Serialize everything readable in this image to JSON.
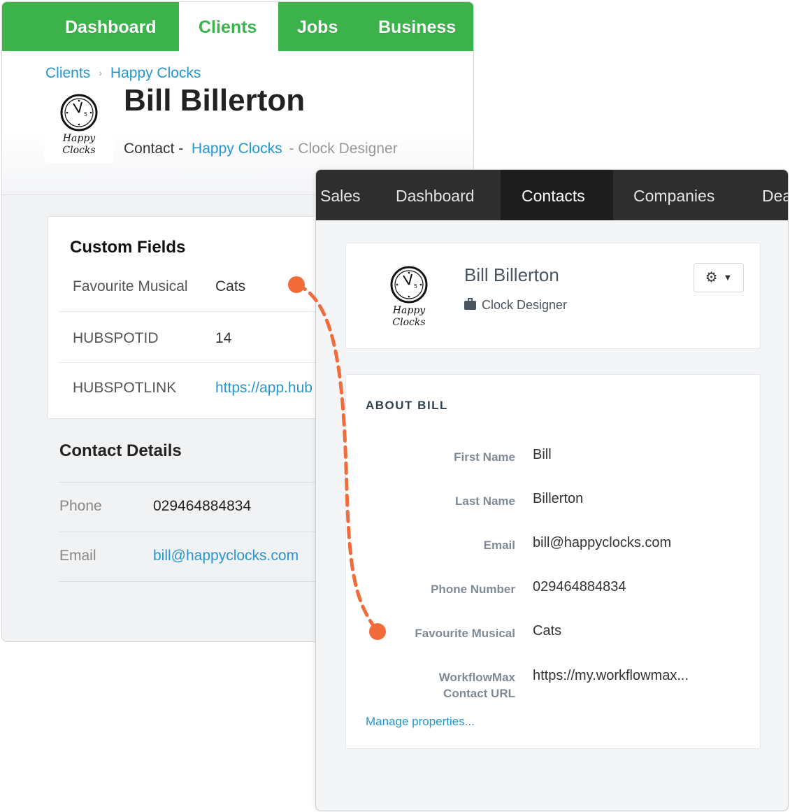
{
  "workflowmax": {
    "nav": [
      {
        "label": "Dashboard",
        "active": false
      },
      {
        "label": "Clients",
        "active": true
      },
      {
        "label": "Jobs",
        "active": false
      },
      {
        "label": "Business",
        "active": false
      }
    ],
    "breadcrumb": {
      "root": "Clients",
      "sep": "›",
      "current": "Happy Clocks"
    },
    "logo": {
      "line1": "Happy",
      "line2": "Clocks"
    },
    "contact_name": "Bill Billerton",
    "subtitle": {
      "prefix": "Contact -",
      "company": "Happy Clocks",
      "dash": "-",
      "role": "Clock Designer"
    },
    "custom_fields": {
      "title": "Custom Fields",
      "rows": [
        {
          "label": "Favourite Musical",
          "value": "Cats",
          "is_link": false
        },
        {
          "label": "HUBSPOTID",
          "value": "14",
          "is_link": false
        },
        {
          "label": "HUBSPOTLINK",
          "value": "https://app.hub",
          "is_link": true
        }
      ]
    },
    "contact_details": {
      "title": "Contact Details",
      "rows": [
        {
          "label": "Phone",
          "value": "029464884834",
          "is_link": false
        },
        {
          "label": "Email",
          "value": "bill@happyclocks.com",
          "is_link": true
        }
      ]
    }
  },
  "hubspot": {
    "nav": [
      {
        "label": "Sales",
        "active": false
      },
      {
        "label": "Dashboard",
        "active": false
      },
      {
        "label": "Contacts",
        "active": true
      },
      {
        "label": "Companies",
        "active": false
      },
      {
        "label": "Deals",
        "active": false
      }
    ],
    "logo": {
      "line1": "Happy",
      "line2": "Clocks"
    },
    "contact_name": "Bill Billerton",
    "job_title": "Clock Designer",
    "about": {
      "title": "ABOUT BILL",
      "properties": [
        {
          "label": "First Name",
          "value": "Bill"
        },
        {
          "label": "Last Name",
          "value": "Billerton"
        },
        {
          "label": "Email",
          "value": "bill@happyclocks.com"
        },
        {
          "label": "Phone Number",
          "value": "029464884834"
        },
        {
          "label": "Favourite Musical",
          "value": "Cats"
        },
        {
          "label": "WorkflowMax Contact URL",
          "value": "https://my.workflowmax..."
        }
      ],
      "manage_link": "Manage properties..."
    }
  },
  "colors": {
    "wfm_green": "#3bb34a",
    "link_blue": "#2596cf",
    "hs_nav_dark": "#2e2e2e",
    "connector_orange": "#f26b3a"
  }
}
